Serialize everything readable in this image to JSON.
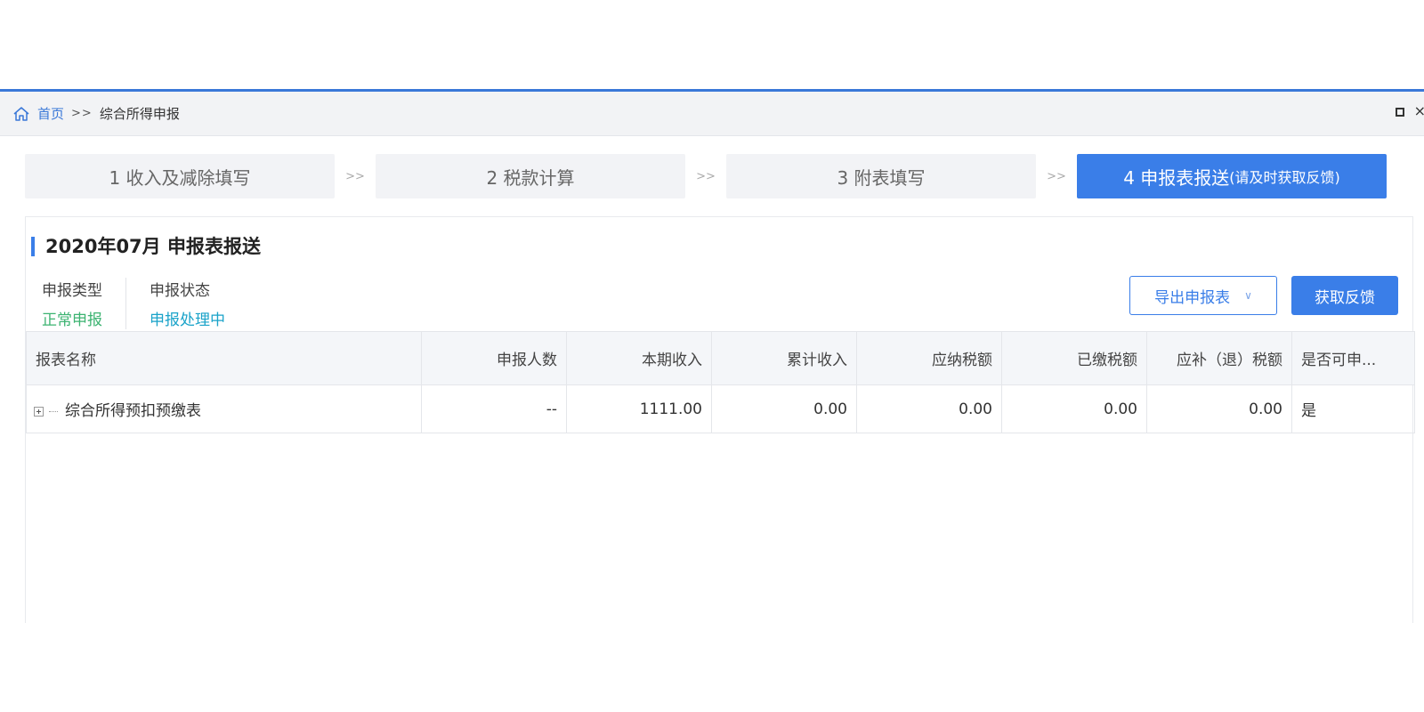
{
  "breadcrumb": {
    "home": "首页",
    "separator": ">>",
    "current": "综合所得申报"
  },
  "steps": [
    {
      "label": "1 收入及减除填写",
      "active": false
    },
    {
      "label": "2 税款计算",
      "active": false
    },
    {
      "label": "3 附表填写",
      "active": false
    },
    {
      "label": "4 申报表报送",
      "sub": "(请及时获取反馈)",
      "active": true
    }
  ],
  "step_separator": ">>",
  "section": {
    "title": "2020年07月  申报表报送",
    "declare_type_label": "申报类型",
    "declare_type_value": "正常申报",
    "declare_status_label": "申报状态",
    "declare_status_value": "申报处理中"
  },
  "buttons": {
    "export": "导出申报表",
    "feedback": "获取反馈"
  },
  "table": {
    "headers": [
      "报表名称",
      "申报人数",
      "本期收入",
      "累计收入",
      "应纳税额",
      "已缴税额",
      "应补（退）税额",
      "是否可申..."
    ],
    "rows": [
      [
        "综合所得预扣预缴表",
        "--",
        "1111.00",
        "0.00",
        "0.00",
        "0.00",
        "0.00",
        "是"
      ]
    ]
  },
  "colors": {
    "accent": "#3a7ee8",
    "status_green": "#3cb371",
    "status_cyan": "#1aa3c9"
  }
}
